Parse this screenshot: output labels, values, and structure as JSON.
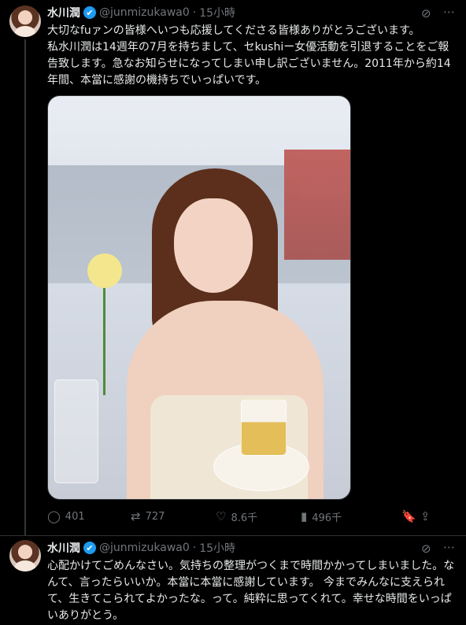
{
  "tweets": [
    {
      "display_name": "水川潤",
      "handle": "@junmizukawa0",
      "dot": "·",
      "time": "15小時",
      "text": "大切なfuァンの皆様へいつも応援してくださる皆様ありがとうございます。\n私水川潤は14週年の7月を持ちまして、セkushiー女優活動を引退することをご報告致します。急なお知らせになってしまい申し訳ございません。2011年から約14年間、本當に感謝の機持ちでいっぱいです。",
      "stats": {
        "replies": "401",
        "retweets": "727",
        "likes": "8.6千",
        "views": "496千"
      }
    },
    {
      "display_name": "水川潤",
      "handle": "@junmizukawa0",
      "dot": "·",
      "time": "15小時",
      "text": "心配かけてごめんなさい。気持ちの整理がつくまで時間かかってしまいました。なんて、言ったらいいか。本當に本當に感謝しています。 今までみんなに支えられて、生きてこられてよかったな。って。純粋に思ってくれて。幸せな時間をいっぱいありがとう。"
    }
  ],
  "icons": {
    "verified": "✔",
    "grok": "⊘",
    "more": "⋯",
    "reply": "◯",
    "retweet": "⇄",
    "like": "♡",
    "views": "▮",
    "bookmark": "🔖",
    "share": "⇪"
  },
  "colors": {
    "background": "#000000",
    "text": "#e7e9ea",
    "muted": "#71767b",
    "verified": "#1d9bf0",
    "divider": "#2f3336"
  }
}
